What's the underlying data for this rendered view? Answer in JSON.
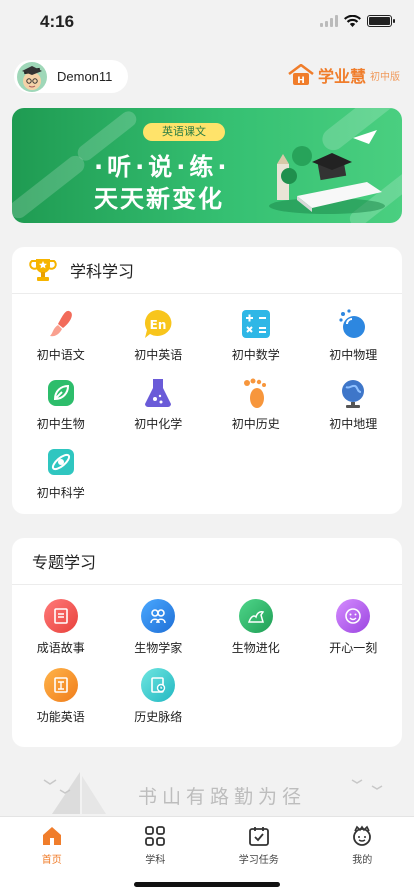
{
  "status": {
    "time": "4:16"
  },
  "user": {
    "name": "Demon11"
  },
  "brand": {
    "name": "学业慧",
    "sub": "初中版"
  },
  "banner": {
    "tag": "英语课文",
    "line1": "·听·说·练·",
    "line2": "天天新变化"
  },
  "subjects": {
    "title": "学科学习",
    "items": [
      {
        "label": "初中语文",
        "icon": "brush-icon"
      },
      {
        "label": "初中英语",
        "icon": "english-icon"
      },
      {
        "label": "初中数学",
        "icon": "math-icon"
      },
      {
        "label": "初中物理",
        "icon": "physics-icon"
      },
      {
        "label": "初中生物",
        "icon": "leaf-icon"
      },
      {
        "label": "初中化学",
        "icon": "flask-icon"
      },
      {
        "label": "初中历史",
        "icon": "footprint-icon"
      },
      {
        "label": "初中地理",
        "icon": "globe-icon"
      },
      {
        "label": "初中科学",
        "icon": "atom-icon"
      }
    ]
  },
  "topics": {
    "title": "专题学习",
    "items": [
      {
        "label": "成语故事",
        "icon": "idiom-icon"
      },
      {
        "label": "生物学家",
        "icon": "biologist-icon"
      },
      {
        "label": "生物进化",
        "icon": "evolution-icon"
      },
      {
        "label": "开心一刻",
        "icon": "smile-icon"
      },
      {
        "label": "功能英语",
        "icon": "english-book-icon"
      },
      {
        "label": "历史脉络",
        "icon": "history-icon"
      }
    ]
  },
  "slogan": "书山有路勤为径",
  "tabbar": [
    {
      "label": "首页",
      "icon": "home-icon",
      "active": true
    },
    {
      "label": "学科",
      "icon": "grid-icon",
      "active": false
    },
    {
      "label": "学习任务",
      "icon": "task-icon",
      "active": false
    },
    {
      "label": "我的",
      "icon": "profile-icon",
      "active": false
    }
  ],
  "colors": {
    "accent": "#f07d2b",
    "banner": "#2fb566"
  }
}
